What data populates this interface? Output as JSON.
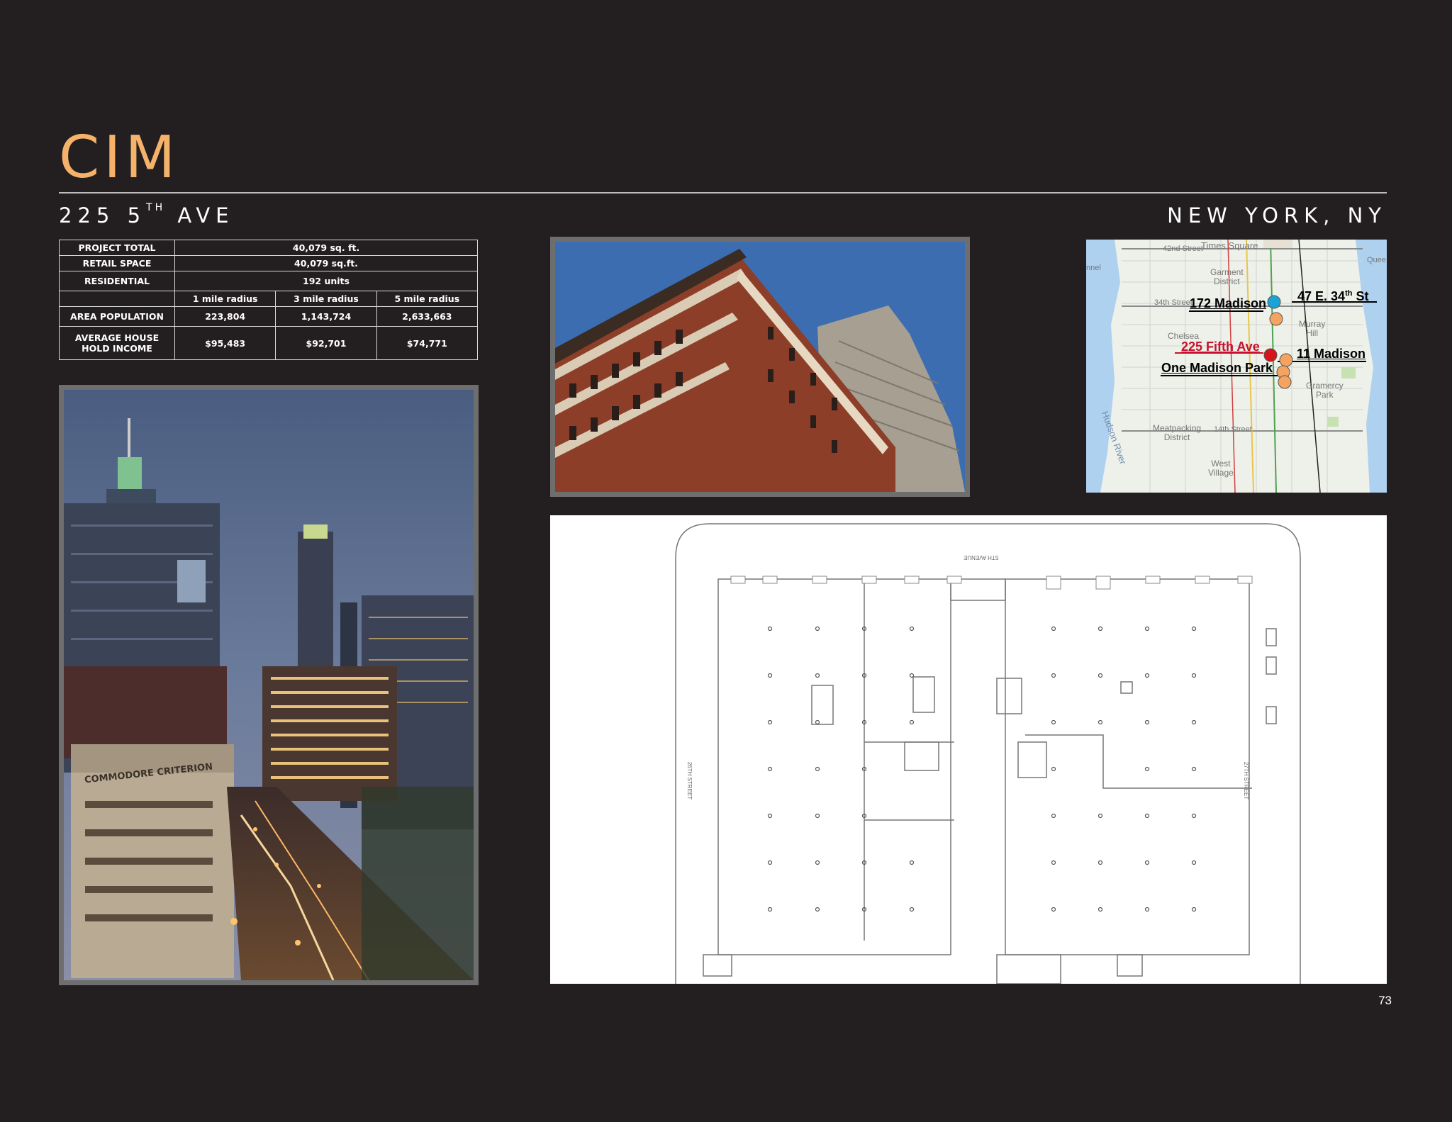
{
  "header": {
    "brand": "CIM",
    "address_main": "225 5",
    "address_sup": "TH",
    "address_tail": "AVE",
    "city": "NEW YORK, NY"
  },
  "stats": {
    "project_total_label": "PROJECT TOTAL",
    "project_total_value": "40,079 sq. ft.",
    "retail_label": "RETAIL SPACE",
    "retail_value": "40,079 sq.ft.",
    "residential_label": "RESIDENTIAL",
    "residential_value": "192 units",
    "radius_headers": [
      "1 mile radius",
      "3 mile radius",
      "5 mile radius"
    ],
    "population_label": "AREA POPULATION",
    "population_values": [
      "223,804",
      "1,143,724",
      "2,633,663"
    ],
    "income_label_line1": "AVERAGE HOUSE",
    "income_label_line2": "HOLD INCOME",
    "income_values": [
      "$95,483",
      "$92,701",
      "$74,771"
    ]
  },
  "photos": {
    "night_sign": "COMMODORE CRITERION"
  },
  "map": {
    "labels": {
      "e34": "47 E. 34",
      "e34_sup": "th",
      "e34_tail": " St",
      "madison172": "172 Madison",
      "fifth225": "225 Fifth Ave",
      "madison11": "11 Madison",
      "one_madison": "One Madison Park"
    },
    "small": {
      "st42": "42nd Street",
      "times_sq": "Times Square",
      "tunnel": "nnel",
      "queens": "Quee",
      "garment": "Garment\nDistrict",
      "st34": "34th Street",
      "murray": "Murray\nHill",
      "chelsea": "Chelsea",
      "gramercy": "Gramercy\nPark",
      "meatpacking": "Meatpacking\nDistrict",
      "st14": "14th Street",
      "west_village": "West\nVillage",
      "hudson": "Hudson River"
    },
    "colors": {
      "target": "#d7141a",
      "competitor": "#f4a460",
      "other": "#1ba3d6"
    }
  },
  "plan": {
    "top_street": "5TH AVENUE",
    "left_street": "26TH STREET",
    "right_street": "27TH STREET"
  },
  "page_number": "73"
}
